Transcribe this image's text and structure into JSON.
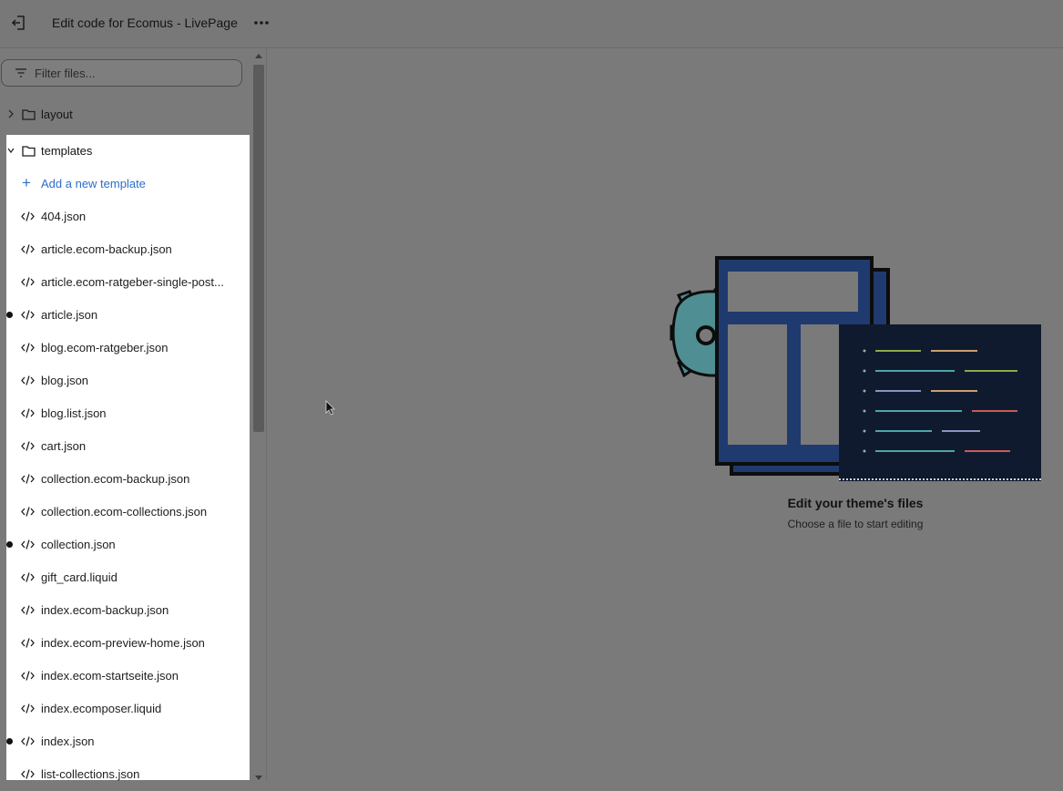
{
  "header": {
    "title": "Edit code for Ecomus - LivePage"
  },
  "sidebar": {
    "filter_placeholder": "Filter files...",
    "folders": [
      {
        "label": "layout",
        "expanded": false
      },
      {
        "label": "templates",
        "expanded": true
      }
    ],
    "add_template_label": "Add a new template",
    "files": [
      {
        "label": "404.json",
        "modified": false
      },
      {
        "label": "article.ecom-backup.json",
        "modified": false
      },
      {
        "label": "article.ecom-ratgeber-single-post...",
        "modified": false
      },
      {
        "label": "article.json",
        "modified": true
      },
      {
        "label": "blog.ecom-ratgeber.json",
        "modified": false
      },
      {
        "label": "blog.json",
        "modified": false
      },
      {
        "label": "blog.list.json",
        "modified": false
      },
      {
        "label": "cart.json",
        "modified": false
      },
      {
        "label": "collection.ecom-backup.json",
        "modified": false
      },
      {
        "label": "collection.ecom-collections.json",
        "modified": false
      },
      {
        "label": "collection.json",
        "modified": true
      },
      {
        "label": "gift_card.liquid",
        "modified": false
      },
      {
        "label": "index.ecom-backup.json",
        "modified": false
      },
      {
        "label": "index.ecom-preview-home.json",
        "modified": false
      },
      {
        "label": "index.ecom-startseite.json",
        "modified": false
      },
      {
        "label": "index.ecomposer.liquid",
        "modified": false
      },
      {
        "label": "index.json",
        "modified": true
      },
      {
        "label": "list-collections.json",
        "modified": false
      }
    ]
  },
  "empty_state": {
    "title": "Edit your theme's files",
    "subtitle": "Choose a file to start editing"
  },
  "colors": {
    "overlay": "#7a7a7a",
    "link": "#2c6ecb",
    "panel": "#ffffff",
    "illustration_navy": "#1f3a6e",
    "illustration_teal": "#4f8f93",
    "code_bg": "#0f1a2e"
  },
  "icons": {
    "exit": "exit-icon",
    "more": "more-horizontal-icon",
    "filter": "filter-icon",
    "folder": "folder-icon",
    "file": "code-icon",
    "add": "plus-icon"
  }
}
